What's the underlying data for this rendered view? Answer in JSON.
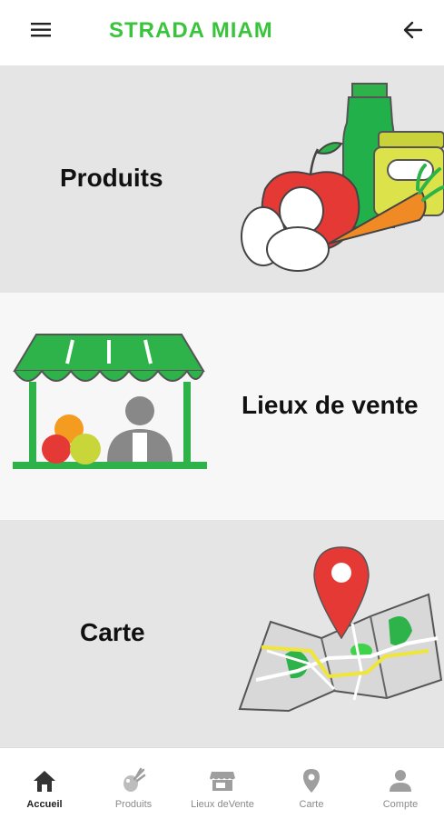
{
  "header": {
    "title": "STRADA MIAM",
    "menu_icon": "hamburger-menu-icon",
    "back_icon": "arrow-left-icon"
  },
  "cards": [
    {
      "label": "Produits",
      "illustration": "grocery-products-illustration"
    },
    {
      "label": "Lieux de vente",
      "illustration": "market-stall-illustration"
    },
    {
      "label": "Carte",
      "illustration": "map-pin-illustration"
    }
  ],
  "bottom_nav": {
    "items": [
      {
        "label": "Accueil",
        "icon": "home-icon",
        "active": true
      },
      {
        "label": "Produits",
        "icon": "produce-icon",
        "active": false
      },
      {
        "label": "Lieux deVente",
        "icon": "storefront-icon",
        "active": false
      },
      {
        "label": "Carte",
        "icon": "location-pin-icon",
        "active": false
      },
      {
        "label": "Compte",
        "icon": "person-icon",
        "active": false
      }
    ]
  },
  "colors": {
    "brand_green": "#39c43b",
    "card_grey": "#e5e5e5",
    "card_white": "#f7f7f7",
    "accent_red": "#e53935",
    "accent_orange": "#f39c1f",
    "nav_active": "#222222",
    "nav_inactive": "#8a8a8a"
  }
}
